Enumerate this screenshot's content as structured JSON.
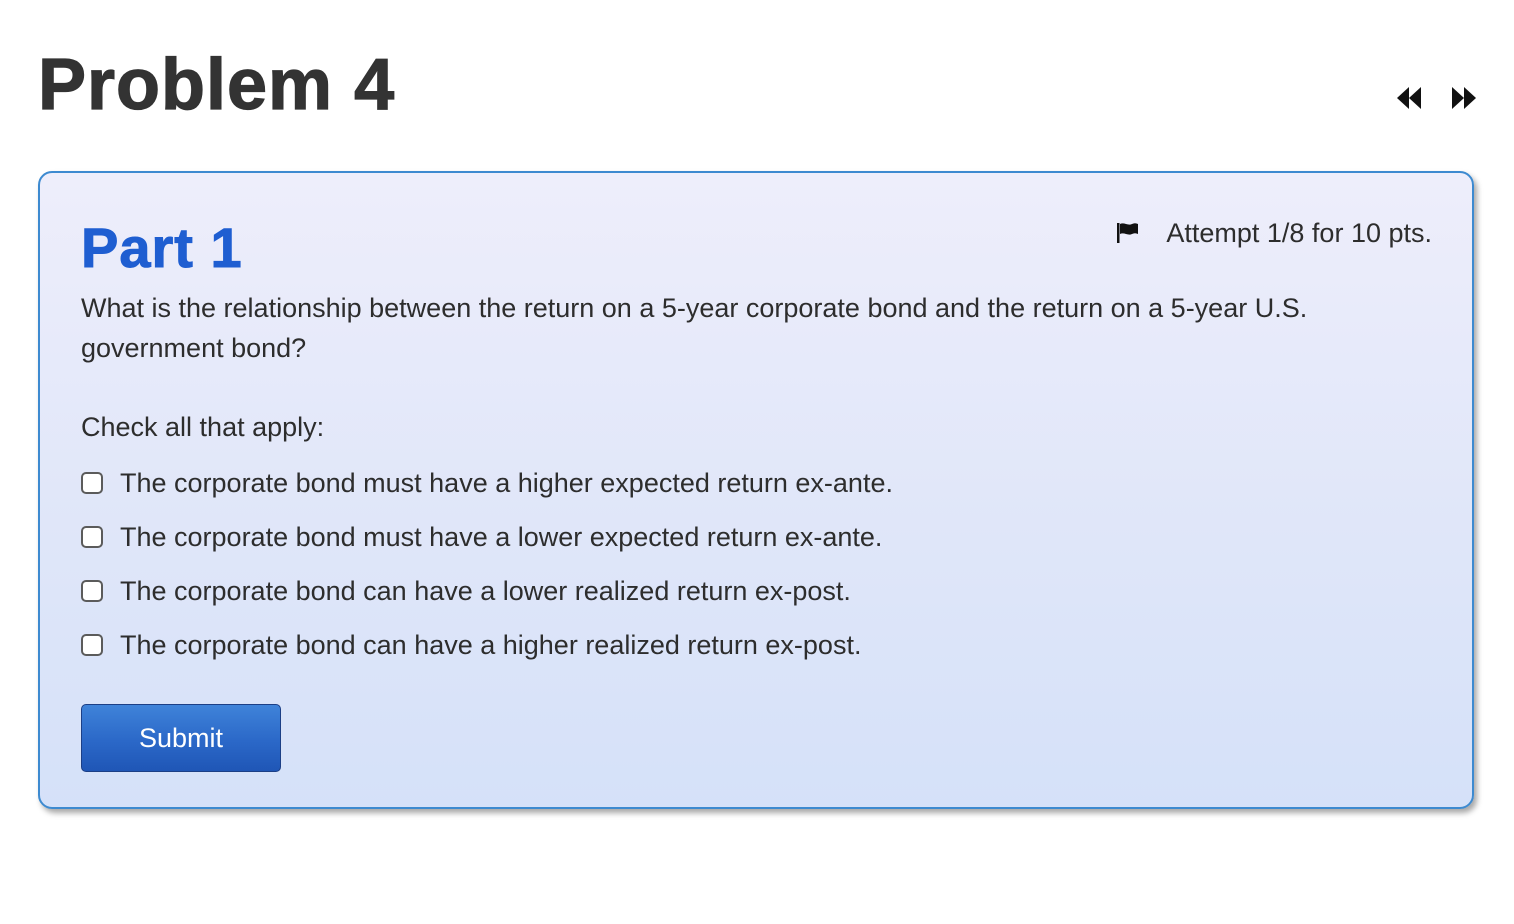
{
  "problem": {
    "title": "Problem 4"
  },
  "navigation": {
    "prev_icon": "rewind-icon",
    "next_icon": "fast-forward-icon"
  },
  "part": {
    "title": "Part 1",
    "attempt_text": "Attempt 1/8 for 10 pts.",
    "flag_icon": "flag-icon",
    "question": "What is the relationship between the return on a 5-year corporate bond and the return on a 5-year U.S. government bond?",
    "instructions": "Check all that apply:",
    "options": [
      {
        "label": "The corporate bond must have a higher expected return ex-ante.",
        "checked": false
      },
      {
        "label": "The corporate bond must have a lower expected return ex-ante.",
        "checked": false
      },
      {
        "label": "The corporate bond can have a lower realized return ex-post.",
        "checked": false
      },
      {
        "label": "The corporate bond can have a higher realized return ex-post.",
        "checked": false
      }
    ],
    "submit_label": "Submit"
  },
  "colors": {
    "part_title": "#1f5ed1",
    "card_border": "#3d8ad0",
    "submit_button": "#2b68c8"
  }
}
